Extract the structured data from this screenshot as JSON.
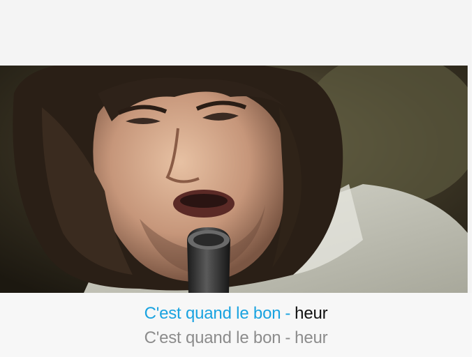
{
  "current_line": {
    "sung": "C'est quand le bon",
    "separator": "-",
    "upcoming": "heur"
  },
  "next_line": {
    "part1": "C'est quand le bon",
    "separator": "-",
    "part2": "heur"
  },
  "colors": {
    "sung": "#1aa3e0",
    "upcoming": "#111111",
    "next_line": "#8c8c8c",
    "background": "#f4f4f4"
  }
}
